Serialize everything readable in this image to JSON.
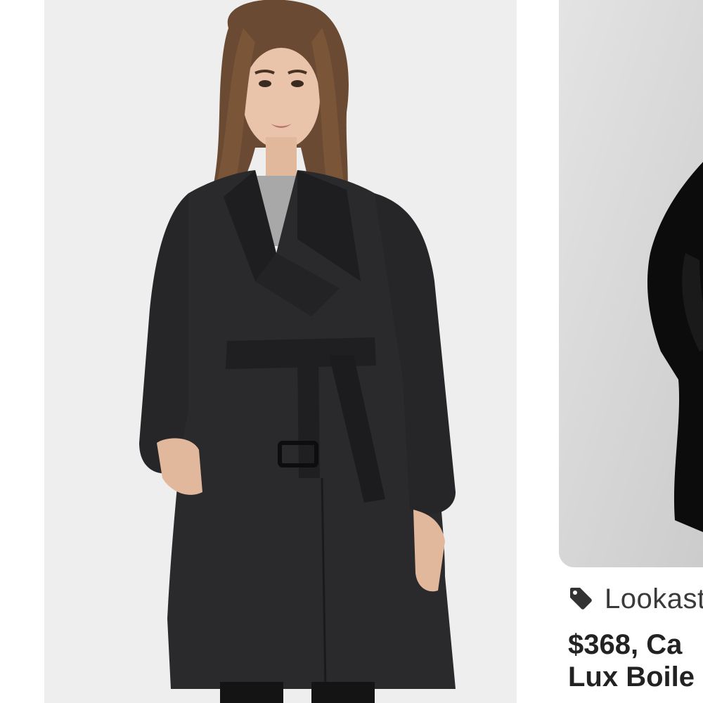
{
  "results": [
    {
      "source": "",
      "title": ""
    },
    {
      "source": "Lookastic",
      "title": "$368, Ca… Lux Boile…",
      "title_line1": "$368, Ca",
      "title_line2": "Lux Boile"
    }
  ],
  "icons": {
    "source_tag": "price-tag-icon"
  },
  "colors": {
    "card_background": "#eeeeee",
    "coat": "#2a2a2c",
    "text_primary": "#222222",
    "text_secondary": "#3a3a3a"
  }
}
